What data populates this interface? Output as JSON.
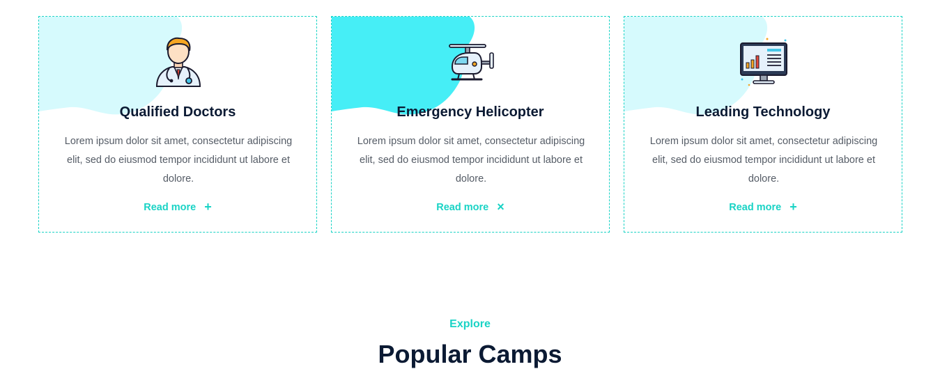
{
  "colors": {
    "accent": "#19d3c5",
    "blob_light": "#d6fafd",
    "blob_active": "#46eef6",
    "heading": "#0b1a33",
    "body_text": "#555c66"
  },
  "cards": [
    {
      "icon": "doctor-icon",
      "title": "Qualified Doctors",
      "text": "Lorem ipsum dolor sit amet, consectetur adipiscing elit, sed do eiusmod tempor incididunt ut labore et dolore.",
      "link_label": "Read more",
      "link_icon": "+",
      "link_icon_name": "plus-icon"
    },
    {
      "icon": "helicopter-icon",
      "title": "Emergency Helicopter",
      "text": "Lorem ipsum dolor sit amet, consectetur adipiscing elit, sed do eiusmod tempor incididunt ut labore et dolore.",
      "link_label": "Read more",
      "link_icon": "×",
      "link_icon_name": "close-icon"
    },
    {
      "icon": "monitor-chart-icon",
      "title": "Leading Technology",
      "text": "Lorem ipsum dolor sit amet, consectetur adipiscing elit, sed do eiusmod tempor incididunt ut labore et dolore.",
      "link_label": "Read more",
      "link_icon": "+",
      "link_icon_name": "plus-icon"
    }
  ],
  "section": {
    "eyebrow": "Explore",
    "title": "Popular Camps"
  }
}
